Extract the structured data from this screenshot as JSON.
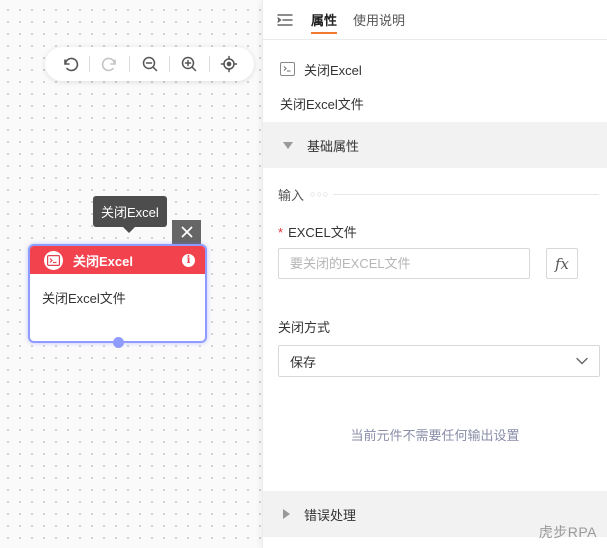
{
  "canvas": {
    "toolbar": {
      "undo": "undo-icon",
      "redo": "redo-icon",
      "zoom_out": "zoom-out-icon",
      "zoom_in": "zoom-in-icon",
      "locate": "locate-icon"
    },
    "tooltip": "关闭Excel",
    "node": {
      "title": "关闭Excel",
      "description": "关闭Excel文件",
      "header_color": "#f2424d",
      "border_color": "#8f9bff"
    }
  },
  "panel": {
    "tabs": [
      {
        "label": "属性",
        "active": true
      },
      {
        "label": "使用说明",
        "active": false
      }
    ],
    "component_name": "关闭Excel",
    "component_desc": "关闭Excel文件",
    "sections": {
      "basic": "基础属性",
      "error": "错误处理"
    },
    "input_group_label": "输入",
    "fields": {
      "excel_file": {
        "label": "EXCEL文件",
        "placeholder": "要关闭的EXCEL文件",
        "fx": "fx"
      },
      "close_mode": {
        "label": "关闭方式",
        "value": "保存"
      }
    },
    "output_note": "当前元件不需要任何输出设置",
    "accent_color": "#f07a30"
  },
  "watermark": "虎步RPA"
}
